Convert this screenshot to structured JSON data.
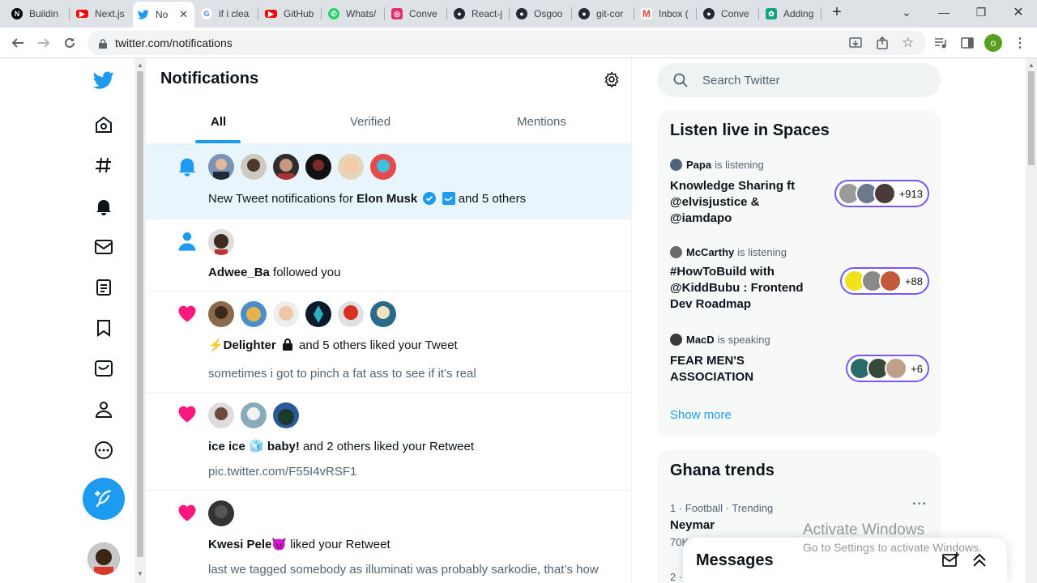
{
  "browser": {
    "tabs": [
      {
        "label": "Buildin",
        "icon": "nextjs-icon",
        "color": "#000000"
      },
      {
        "label": "Next.js",
        "icon": "youtube-icon",
        "color": "#ff0000"
      },
      {
        "label": "No",
        "icon": "twitter-icon",
        "color": "#1d9bf0"
      },
      {
        "label": "if i clea",
        "icon": "google-icon",
        "color": "#4285f4"
      },
      {
        "label": "GitHub",
        "icon": "youtube-icon",
        "color": "#ff0000"
      },
      {
        "label": "Whats/",
        "icon": "whatsapp-icon",
        "color": "#25d366"
      },
      {
        "label": "Conve",
        "icon": "instagram-icon",
        "color": "#e1306c"
      },
      {
        "label": "React-j",
        "icon": "github-icon",
        "color": "#24292f"
      },
      {
        "label": "Osgoo",
        "icon": "github-icon",
        "color": "#24292f"
      },
      {
        "label": "git-cor",
        "icon": "github-icon",
        "color": "#24292f"
      },
      {
        "label": "Inbox (",
        "icon": "gmail-icon",
        "color": "#ea4335"
      },
      {
        "label": "Conve",
        "icon": "github-icon",
        "color": "#24292f"
      },
      {
        "label": "Adding",
        "icon": "chatgpt-icon",
        "color": "#10a37f"
      }
    ],
    "url": "twitter.com/notifications",
    "profile_initial": "o"
  },
  "header": {
    "title": "Notifications",
    "tabs": [
      "All",
      "Verified",
      "Mentions"
    ]
  },
  "notifications": [
    {
      "type": "bell",
      "text_prefix": "New Tweet notifications for ",
      "name": "Elon Musk",
      "text_suffix": " and 5 others"
    },
    {
      "type": "follow",
      "name": "Adwee_Ba",
      "text_suffix": " followed you"
    },
    {
      "type": "like",
      "name": "⚡Delighter",
      "text_suffix": " and 5 others liked your Tweet",
      "sub": "sometimes i got to pinch a fat ass to see if it’s real"
    },
    {
      "type": "like",
      "name": "ice ice 🧊 baby!",
      "text_suffix": " and 2 others liked your Retweet",
      "sub": "pic.twitter.com/F55I4vRSF1"
    },
    {
      "type": "like",
      "name": "Kwesi Pele😈",
      "text_suffix": " liked your Retweet",
      "sub": "last we tagged somebody as illuminati was probably sarkodie, that’s how"
    }
  ],
  "sidebar": {
    "search_placeholder": "Search Twitter",
    "spaces_title": "Listen live in Spaces",
    "spaces": [
      {
        "host": "Papa",
        "status": "is listening",
        "title": "Knowledge Sharing ft @elvisjustice & @iamdapo",
        "count": "+913"
      },
      {
        "host": "McCarthy",
        "status": "is listening",
        "title": "#HowToBuild with @KiddBubu : Frontend Dev Roadmap",
        "count": "+88"
      },
      {
        "host": "MacD",
        "status": "is speaking",
        "title": "FEAR MEN'S ASSOCIATION",
        "count": "+6"
      }
    ],
    "show_more": "Show more",
    "trends_title": "Ghana trends",
    "trends": [
      {
        "meta": "1 · Football · Trending",
        "name": "Neymar",
        "count": "70K"
      },
      {
        "meta": "2 ·"
      }
    ],
    "messages_title": "Messages"
  },
  "watermark": {
    "line1": "Activate Windows",
    "line2": "Go to Settings to activate Windows."
  },
  "colors": {
    "accent": "#1d9bf0",
    "like": "#f91880",
    "spaces": "#7856ff"
  }
}
